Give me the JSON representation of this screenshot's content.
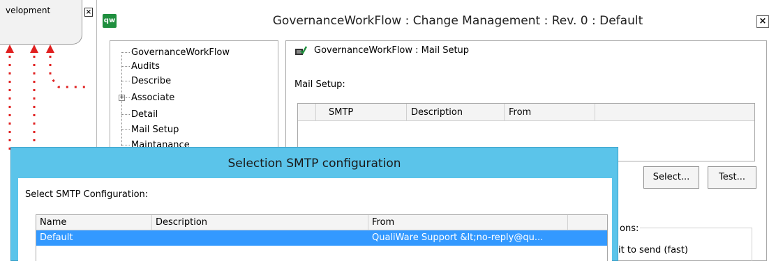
{
  "background": {
    "node_label": "velopment",
    "close_glyph": "×"
  },
  "window": {
    "app_icon": "qw",
    "title": "GovernanceWorkFlow : Change Management : Rev. 0  : Default",
    "close_glyph": "×"
  },
  "tree": {
    "items": [
      {
        "label": "GovernanceWorkFlow"
      },
      {
        "label": "Audits"
      },
      {
        "label": "Describe"
      },
      {
        "label": "Associate"
      },
      {
        "label": "Detail"
      },
      {
        "label": "Mail Setup"
      },
      {
        "label": "Maintanance"
      }
    ],
    "expand_glyph": "+"
  },
  "content": {
    "title": "GovernanceWorkFlow : Mail Setup",
    "mail_setup_label": "Mail Setup:",
    "grid_columns": [
      "",
      "SMTP",
      "Description",
      "From",
      ""
    ],
    "select_button": "Select...",
    "test_button": "Test...",
    "options_fragment": "ons:",
    "send_fragment": "it to send (fast)"
  },
  "dialog": {
    "title": "Selection SMTP configuration",
    "label": "Select SMTP Configuration:",
    "columns": [
      "Name",
      "Description",
      "From"
    ],
    "rows": [
      {
        "name": "Default",
        "description": "",
        "from": "QualiWare Support &lt;no-reply@qu..."
      }
    ]
  },
  "colors": {
    "dialog_frame": "#5bc4ea",
    "selection": "#3399ff",
    "annotation_red": "#e02020",
    "app_icon_green": "#1f8f3e"
  }
}
